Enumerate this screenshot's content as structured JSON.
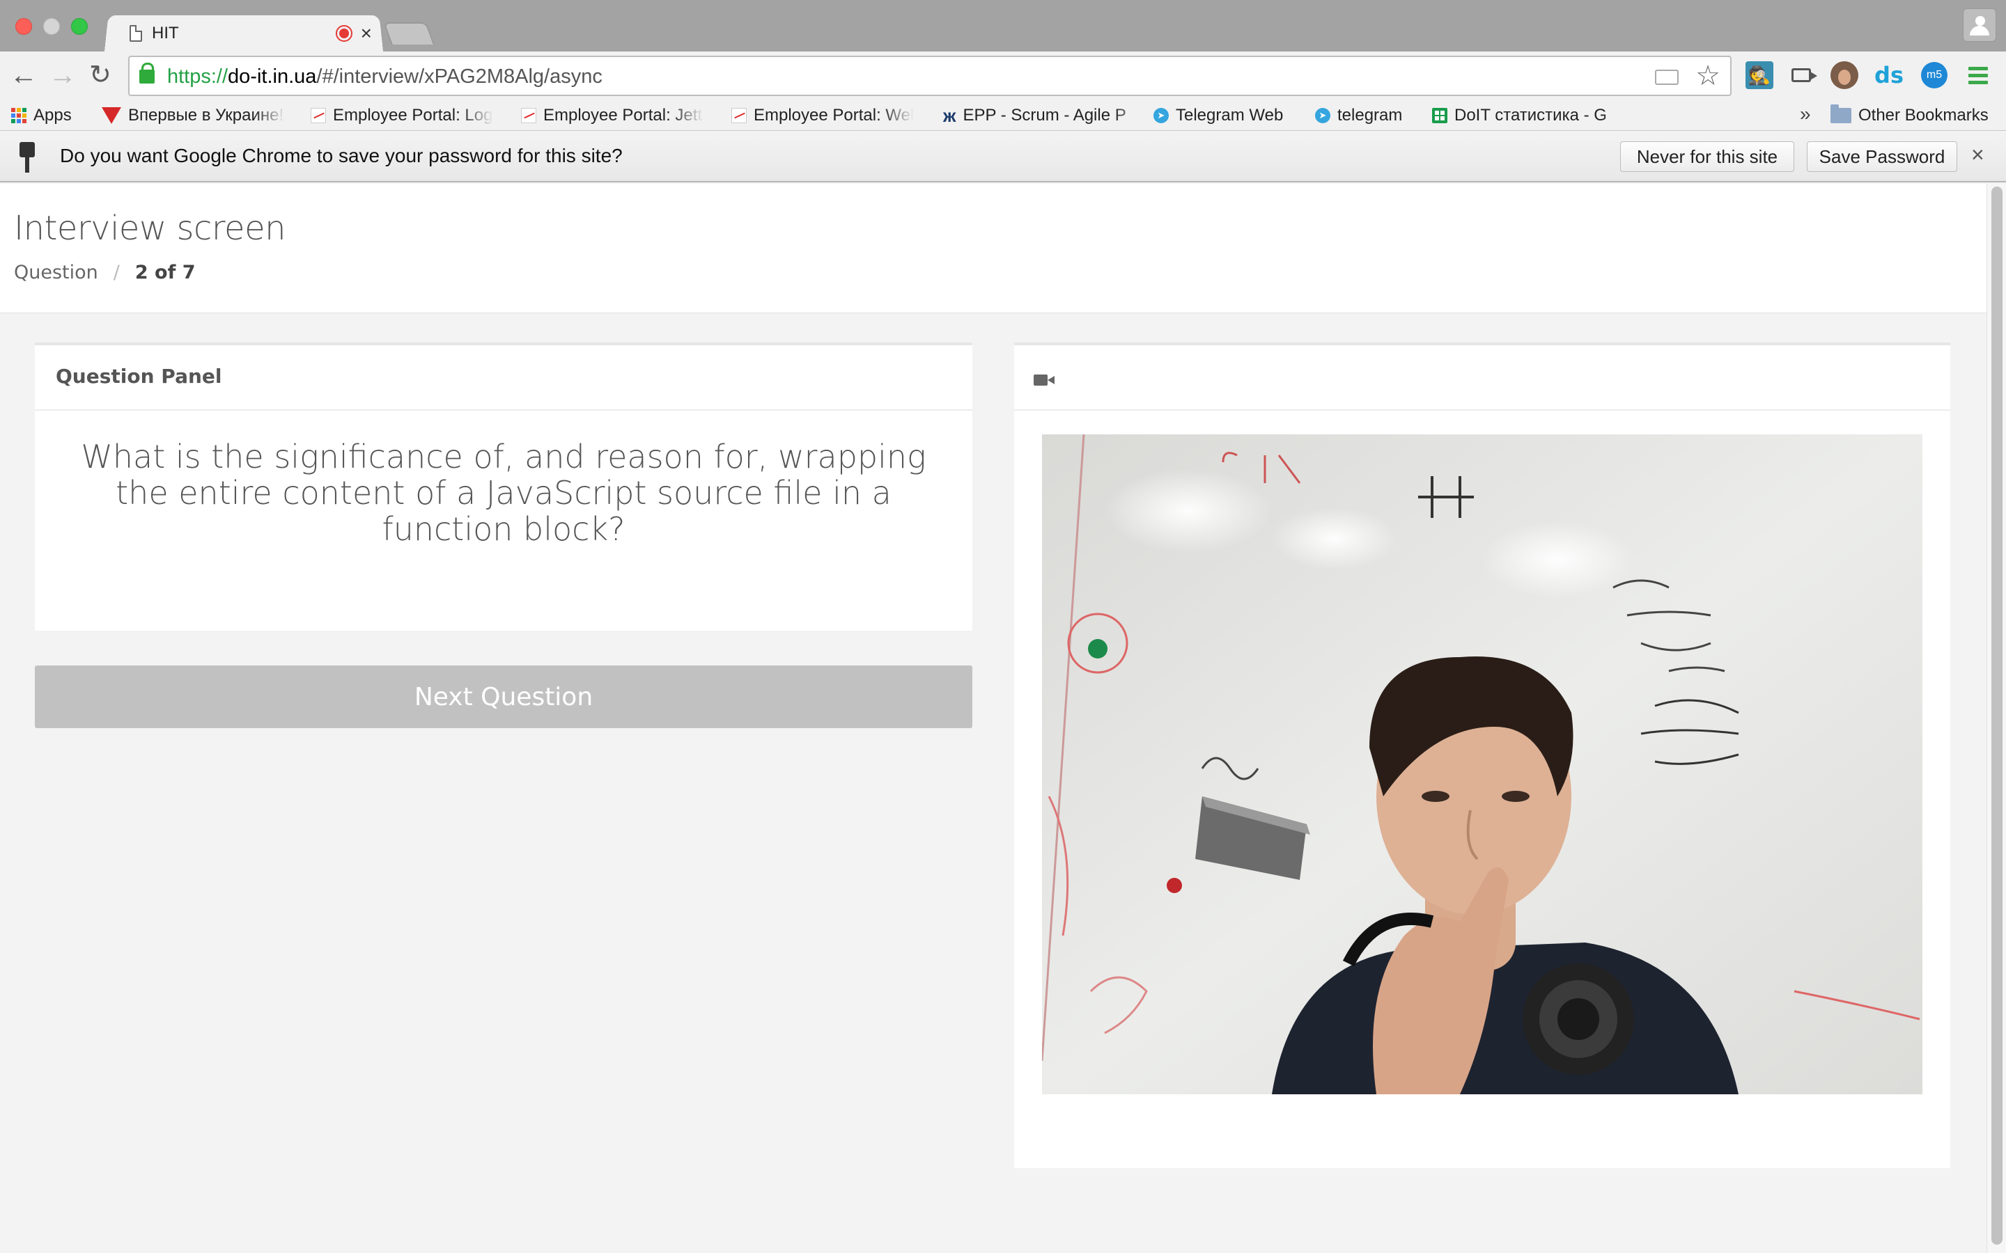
{
  "browser": {
    "tab_title": "HIT",
    "url": {
      "scheme": "https://",
      "host": "do-it.in.ua",
      "path": "/#/interview/xPAG2M8Alg/async"
    },
    "extensions": {
      "ds_label": "ds",
      "mb_label": "m5"
    }
  },
  "bookmarks": {
    "items": [
      {
        "label": "Apps"
      },
      {
        "label": "Впервые в Украине!"
      },
      {
        "label": "Employee Portal: Log"
      },
      {
        "label": "Employee Portal: Jett"
      },
      {
        "label": "Employee Portal: Wel"
      },
      {
        "label": "EPP - Scrum - Agile P"
      },
      {
        "label": "Telegram Web"
      },
      {
        "label": "telegram"
      },
      {
        "label": "DoIT статистика - G"
      }
    ],
    "overflow": "»",
    "other": "Other Bookmarks"
  },
  "infobar": {
    "message": "Do you want Google Chrome to save your password for this site?",
    "never_label": "Never for this site",
    "save_label": "Save Password",
    "close": "×"
  },
  "page": {
    "title": "Interview screen",
    "breadcrumb": {
      "parent": "Question",
      "separator": "/",
      "current": "2 of 7"
    },
    "question_panel": {
      "heading": "Question Panel",
      "question": "What is the significance of, and reason for, wrapping the entire content of a JavaScript source file in a function block?"
    },
    "next_button": "Next Question"
  },
  "colors": {
    "accent_green": "#24a145",
    "button_disabled": "#c1c1c1",
    "record_red": "#e53935"
  }
}
